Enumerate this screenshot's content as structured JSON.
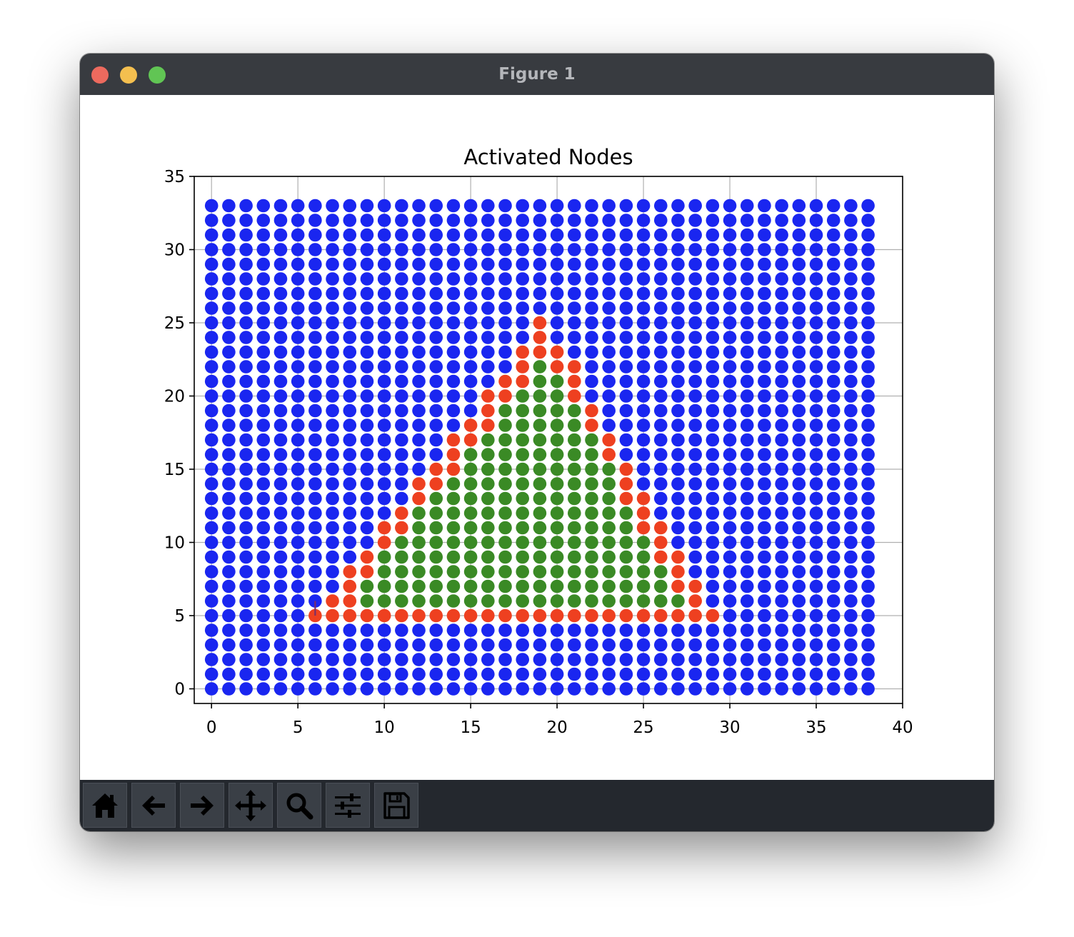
{
  "window": {
    "title": "Figure 1"
  },
  "toolbar": {
    "buttons": [
      {
        "name": "home-button",
        "icon": "home-icon"
      },
      {
        "name": "back-button",
        "icon": "arrow-left-icon"
      },
      {
        "name": "forward-button",
        "icon": "arrow-right-icon"
      },
      {
        "name": "pan-button",
        "icon": "move-icon"
      },
      {
        "name": "zoom-button",
        "icon": "magnifier-icon"
      },
      {
        "name": "configure-subplots-button",
        "icon": "sliders-icon"
      },
      {
        "name": "save-button",
        "icon": "floppy-disk-icon"
      }
    ]
  },
  "colors": {
    "inactive": "#1a26f0",
    "frontier": "#ee4020",
    "activated": "#3a8a25",
    "marker": "#7a2f6a"
  },
  "chart_data": {
    "type": "scatter",
    "title": "Activated Nodes",
    "xlabel": "",
    "ylabel": "",
    "xlim": [
      -1,
      40
    ],
    "ylim": [
      -1,
      35
    ],
    "xticks": [
      0,
      5,
      10,
      15,
      20,
      25,
      30,
      35,
      40
    ],
    "yticks": [
      0,
      5,
      10,
      15,
      20,
      25,
      30,
      35
    ],
    "grid": true,
    "grid_nodes": {
      "x_range": [
        0,
        38
      ],
      "y_range": [
        0,
        33
      ],
      "default_state": "inactive"
    },
    "frontier_nodes": [
      [
        6,
        5
      ],
      [
        7,
        5
      ],
      [
        8,
        5
      ],
      [
        9,
        5
      ],
      [
        10,
        5
      ],
      [
        11,
        5
      ],
      [
        12,
        5
      ],
      [
        13,
        5
      ],
      [
        14,
        5
      ],
      [
        15,
        5
      ],
      [
        16,
        5
      ],
      [
        17,
        5
      ],
      [
        18,
        5
      ],
      [
        19,
        5
      ],
      [
        20,
        5
      ],
      [
        21,
        5
      ],
      [
        22,
        5
      ],
      [
        23,
        5
      ],
      [
        24,
        5
      ],
      [
        25,
        5
      ],
      [
        26,
        5
      ],
      [
        27,
        5
      ],
      [
        28,
        5
      ],
      [
        29,
        5
      ],
      [
        7,
        6
      ],
      [
        8,
        6
      ],
      [
        8,
        7
      ],
      [
        8,
        8
      ],
      [
        9,
        8
      ],
      [
        9,
        9
      ],
      [
        10,
        10
      ],
      [
        10,
        11
      ],
      [
        11,
        11
      ],
      [
        11,
        12
      ],
      [
        12,
        13
      ],
      [
        12,
        14
      ],
      [
        13,
        14
      ],
      [
        13,
        15
      ],
      [
        14,
        15
      ],
      [
        14,
        16
      ],
      [
        14,
        17
      ],
      [
        15,
        17
      ],
      [
        15,
        18
      ],
      [
        16,
        18
      ],
      [
        16,
        19
      ],
      [
        16,
        20
      ],
      [
        17,
        20
      ],
      [
        17,
        21
      ],
      [
        18,
        21
      ],
      [
        18,
        22
      ],
      [
        18,
        23
      ],
      [
        19,
        23
      ],
      [
        19,
        24
      ],
      [
        19,
        25
      ],
      [
        20,
        23
      ],
      [
        20,
        22
      ],
      [
        21,
        22
      ],
      [
        21,
        21
      ],
      [
        21,
        20
      ],
      [
        22,
        19
      ],
      [
        22,
        18
      ],
      [
        23,
        17
      ],
      [
        23,
        16
      ],
      [
        24,
        15
      ],
      [
        24,
        14
      ],
      [
        24,
        13
      ],
      [
        25,
        13
      ],
      [
        25,
        12
      ],
      [
        25,
        11
      ],
      [
        26,
        11
      ],
      [
        26,
        10
      ],
      [
        26,
        9
      ],
      [
        27,
        9
      ],
      [
        27,
        8
      ],
      [
        27,
        7
      ],
      [
        28,
        7
      ],
      [
        28,
        6
      ]
    ],
    "activated_columns": [
      {
        "x": 9,
        "y_range": [
          6,
          7
        ]
      },
      {
        "x": 10,
        "y_range": [
          6,
          9
        ]
      },
      {
        "x": 11,
        "y_range": [
          6,
          10
        ]
      },
      {
        "x": 12,
        "y_range": [
          6,
          12
        ]
      },
      {
        "x": 13,
        "y_range": [
          6,
          13
        ]
      },
      {
        "x": 14,
        "y_range": [
          6,
          14
        ]
      },
      {
        "x": 15,
        "y_range": [
          6,
          16
        ]
      },
      {
        "x": 16,
        "y_range": [
          6,
          17
        ]
      },
      {
        "x": 17,
        "y_range": [
          6,
          19
        ]
      },
      {
        "x": 18,
        "y_range": [
          6,
          20
        ]
      },
      {
        "x": 19,
        "y_range": [
          6,
          22
        ]
      },
      {
        "x": 20,
        "y_range": [
          6,
          21
        ]
      },
      {
        "x": 21,
        "y_range": [
          6,
          19
        ]
      },
      {
        "x": 22,
        "y_range": [
          6,
          17
        ]
      },
      {
        "x": 23,
        "y_range": [
          6,
          15
        ]
      },
      {
        "x": 24,
        "y_range": [
          6,
          12
        ]
      },
      {
        "x": 25,
        "y_range": [
          6,
          10
        ]
      },
      {
        "x": 26,
        "y_range": [
          6,
          8
        ]
      },
      {
        "x": 27,
        "y_range": [
          6,
          6
        ]
      }
    ],
    "start_marker": {
      "x": 6,
      "y_range": [
        5,
        6
      ]
    }
  }
}
